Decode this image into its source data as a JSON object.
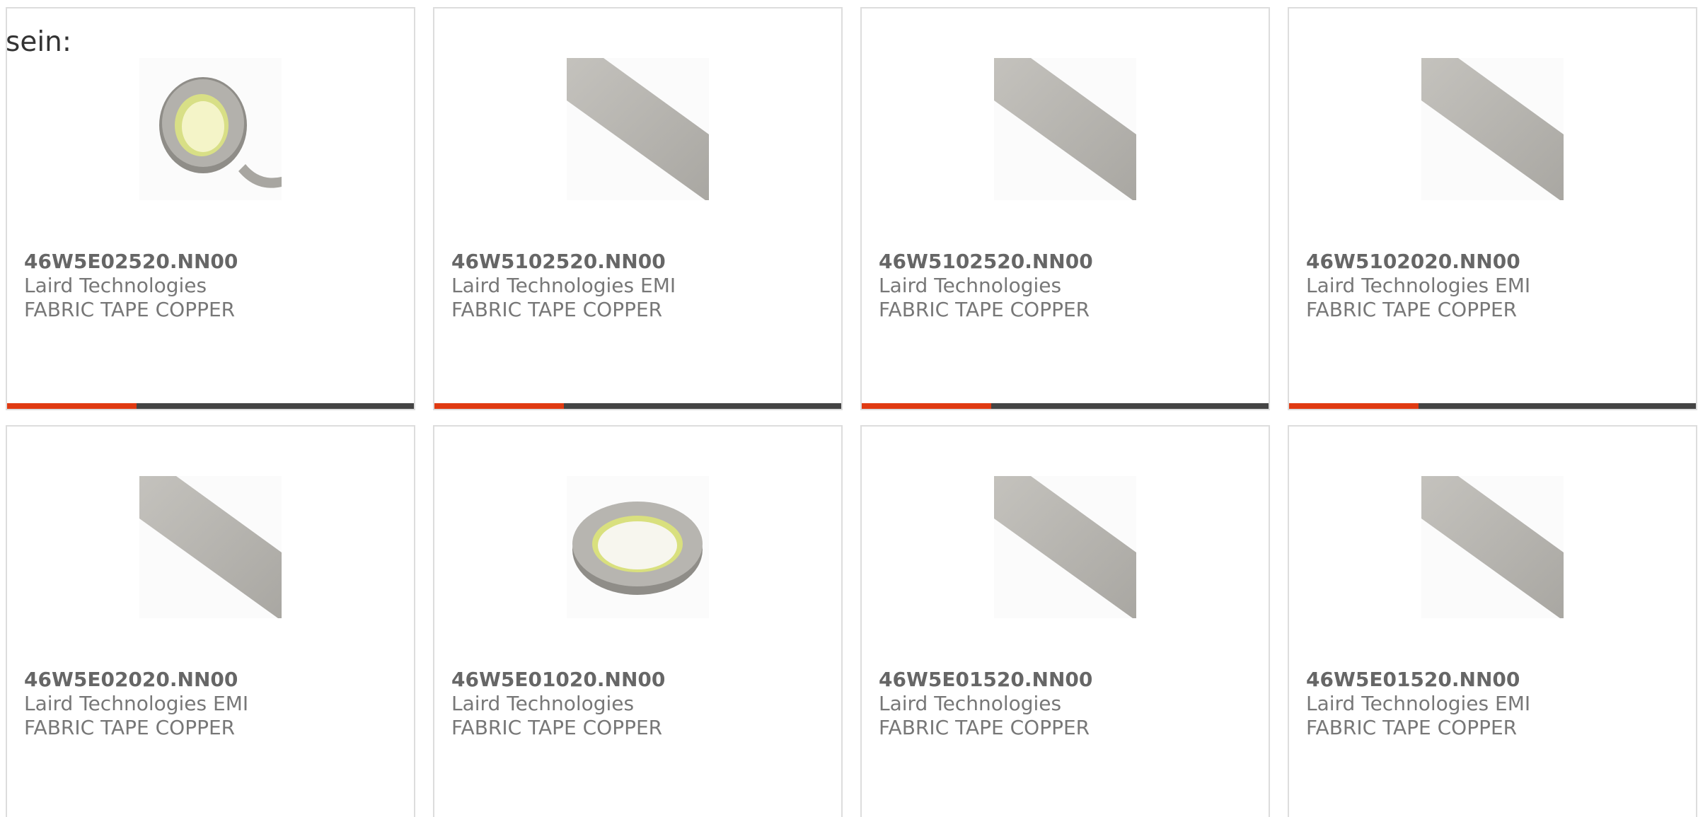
{
  "intro_text": "sein:",
  "colors": {
    "accent": "#e03a12",
    "bar_dark": "#444444",
    "border": "#dddddd",
    "text_bold": "#666666",
    "text": "#777777"
  },
  "products": [
    {
      "part_number": "46W5E02520.NN00",
      "manufacturer": "Laird Technologies",
      "description": "FABRIC TAPE COPPER",
      "image": "tape-roll-image",
      "accent_bar": true
    },
    {
      "part_number": "46W5102520.NN00",
      "manufacturer": "Laird Technologies EMI",
      "description": "FABRIC TAPE COPPER",
      "image": "tape-strip-image",
      "accent_bar": true
    },
    {
      "part_number": "46W5102520.NN00",
      "manufacturer": "Laird Technologies",
      "description": "FABRIC TAPE COPPER",
      "image": "tape-strip-image",
      "accent_bar": true
    },
    {
      "part_number": "46W5102020.NN00",
      "manufacturer": "Laird Technologies EMI",
      "description": "FABRIC TAPE COPPER",
      "image": "tape-strip-image",
      "accent_bar": true
    },
    {
      "part_number": "46W5E02020.NN00",
      "manufacturer": "Laird Technologies EMI",
      "description": "FABRIC TAPE COPPER",
      "image": "tape-strip-image",
      "accent_bar": false
    },
    {
      "part_number": "46W5E01020.NN00",
      "manufacturer": "Laird Technologies",
      "description": "FABRIC TAPE COPPER",
      "image": "tape-roll-flat-image",
      "accent_bar": false
    },
    {
      "part_number": "46W5E01520.NN00",
      "manufacturer": "Laird Technologies",
      "description": "FABRIC TAPE COPPER",
      "image": "tape-strip-image",
      "accent_bar": false
    },
    {
      "part_number": "46W5E01520.NN00",
      "manufacturer": "Laird Technologies EMI",
      "description": "FABRIC TAPE COPPER",
      "image": "tape-strip-image",
      "accent_bar": false
    }
  ]
}
